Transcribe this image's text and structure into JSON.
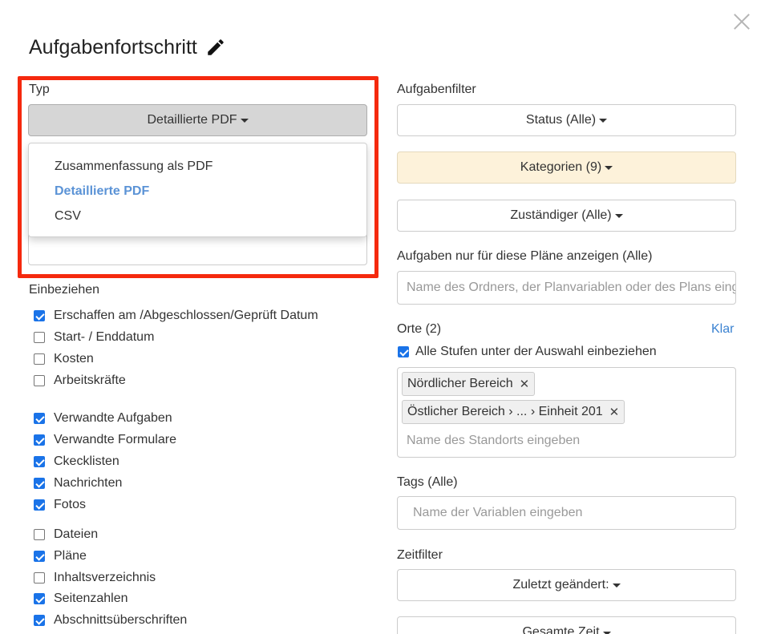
{
  "modal": {
    "title": "Aufgabenfortschritt",
    "close_icon": "close-icon",
    "edit_icon": "pencil-icon"
  },
  "left": {
    "type_label": "Typ",
    "type_selected": "Detaillierte PDF",
    "type_options": [
      "Zusammenfassung als PDF",
      "Detaillierte PDF",
      "CSV"
    ],
    "include_label": "Einbeziehen",
    "checkboxes": [
      {
        "label": "Erschaffen am /Abgeschlossen/Geprüft Datum",
        "checked": true
      },
      {
        "label": "Start- / Enddatum",
        "checked": false
      },
      {
        "label": "Kosten",
        "checked": false
      },
      {
        "label": "Arbeitskräfte",
        "checked": false
      },
      {
        "label": "Verwandte Aufgaben",
        "checked": true
      },
      {
        "label": "Verwandte Formulare",
        "checked": true
      },
      {
        "label": "Ckecklisten",
        "checked": true
      },
      {
        "label": "Nachrichten",
        "checked": true
      },
      {
        "label": "Fotos",
        "checked": true
      },
      {
        "label": "Dateien",
        "checked": false
      },
      {
        "label": "Pläne",
        "checked": true
      },
      {
        "label": "Inhaltsverzeichnis",
        "checked": false
      },
      {
        "label": "Seitenzahlen",
        "checked": true
      },
      {
        "label": "Abschnittsüberschriften",
        "checked": true
      }
    ]
  },
  "right": {
    "task_filter_label": "Aufgabenfilter",
    "status_btn": "Status (Alle)",
    "categories_btn": "Kategorien (9)",
    "assignee_btn": "Zuständiger (Alle)",
    "plans_label": "Aufgaben nur für diese Pläne anzeigen (Alle)",
    "plans_placeholder": "Name des Ordners, der Planvariablen oder des Plans eingeben",
    "locations_label": "Orte (2)",
    "clear_link": "Klar",
    "include_levels": "Alle Stufen unter der Auswahl einbeziehen",
    "include_levels_checked": true,
    "location_chips": [
      "Nördlicher Bereich",
      "Östlicher Bereich › ... › Einheit 201"
    ],
    "location_placeholder": "Name des Standorts eingeben",
    "tags_label": "Tags (Alle)",
    "tags_placeholder": "Name der Variablen eingeben",
    "time_filter_label": "Zeitfilter",
    "last_changed_btn": "Zuletzt geändert:",
    "total_time_btn": "Gesamte Zeit"
  },
  "colors": {
    "highlight": "#f5290e",
    "link": "#3b82d1",
    "active_option": "#5b93d6",
    "checkbox": "#1a73e8",
    "categories_bg": "#fdf2da"
  }
}
